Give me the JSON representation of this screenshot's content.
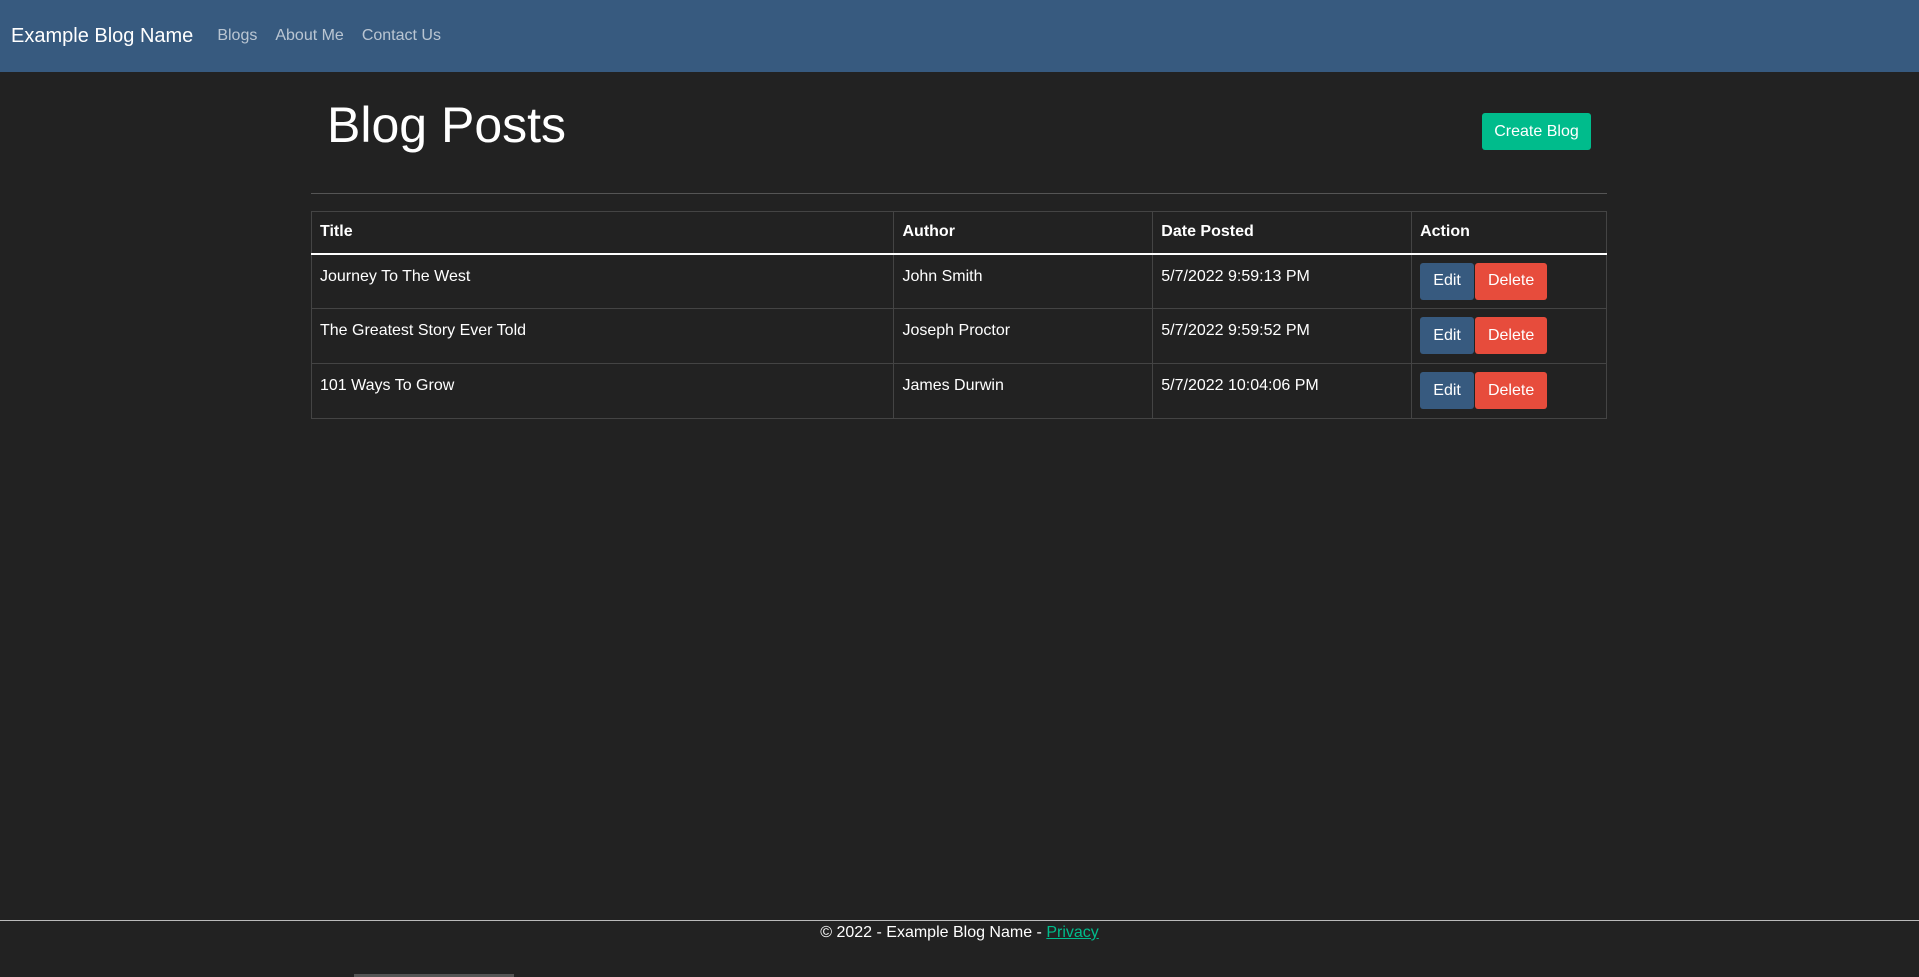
{
  "navbar": {
    "brand": "Example Blog Name",
    "links": [
      "Blogs",
      "About Me",
      "Contact Us"
    ]
  },
  "page": {
    "title": "Blog Posts",
    "create_label": "Create Blog"
  },
  "table": {
    "headers": [
      "Title",
      "Author",
      "Date Posted",
      "Action"
    ],
    "rows": [
      {
        "title": "Journey To The West",
        "author": "John Smith",
        "date": "5/7/2022 9:59:13 PM"
      },
      {
        "title": "The Greatest Story Ever Told",
        "author": "Joseph Proctor",
        "date": "5/7/2022 9:59:52 PM"
      },
      {
        "title": "101 Ways To Grow",
        "author": "James Durwin",
        "date": "5/7/2022 10:04:06 PM"
      }
    ],
    "edit_label": "Edit",
    "delete_label": "Delete"
  },
  "footer": {
    "text": "© 2022 - Example Blog Name - ",
    "privacy_label": "Privacy"
  },
  "colors": {
    "navbar": "#375a7f",
    "background": "#222222",
    "success": "#00bc8c",
    "danger": "#e74c3c",
    "primary": "#375a7f"
  }
}
